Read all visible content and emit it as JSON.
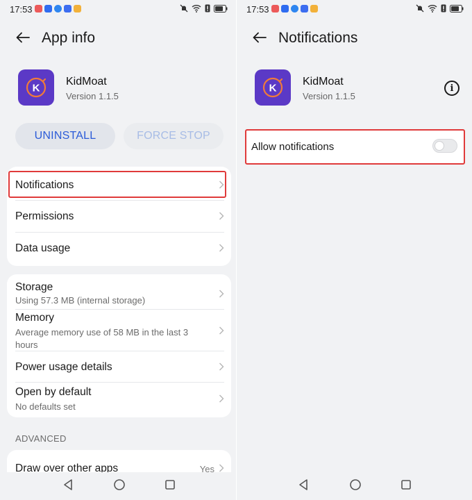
{
  "status_bar": {
    "time": "17:53",
    "app_icon_colors": [
      "#ec5a5a",
      "#2f6cf0",
      "#2f86f0",
      "#3c6df0",
      "#f2b13a"
    ]
  },
  "app_info": {
    "title": "App info",
    "app": {
      "name": "KidMoat",
      "version": "Version 1.1.5",
      "icon_letter": "K",
      "icon_color": "#5b39c6"
    },
    "buttons": {
      "uninstall": "UNINSTALL",
      "force_stop": "FORCE STOP"
    },
    "items": {
      "notifications": "Notifications",
      "permissions": "Permissions",
      "data_usage": "Data usage",
      "storage": {
        "label": "Storage",
        "sub": "Using 57.3 MB (internal storage)"
      },
      "memory": {
        "label": "Memory",
        "sub": "Average memory use of 58 MB in the last 3 hours"
      },
      "power_usage": "Power usage details",
      "open_by_default": {
        "label": "Open by default",
        "sub": "No defaults set"
      }
    },
    "advanced_header": "ADVANCED",
    "draw_over": {
      "label": "Draw over other apps",
      "value": "Yes"
    }
  },
  "notifications_page": {
    "title": "Notifications",
    "app": {
      "name": "KidMoat",
      "version": "Version 1.1.5",
      "icon_letter": "K"
    },
    "allow_notifications": {
      "label": "Allow notifications",
      "enabled": false
    }
  },
  "colors": {
    "accent": "#2b5bd8",
    "highlight": "#e03a3a",
    "icon_ring": "#f07a3a"
  }
}
